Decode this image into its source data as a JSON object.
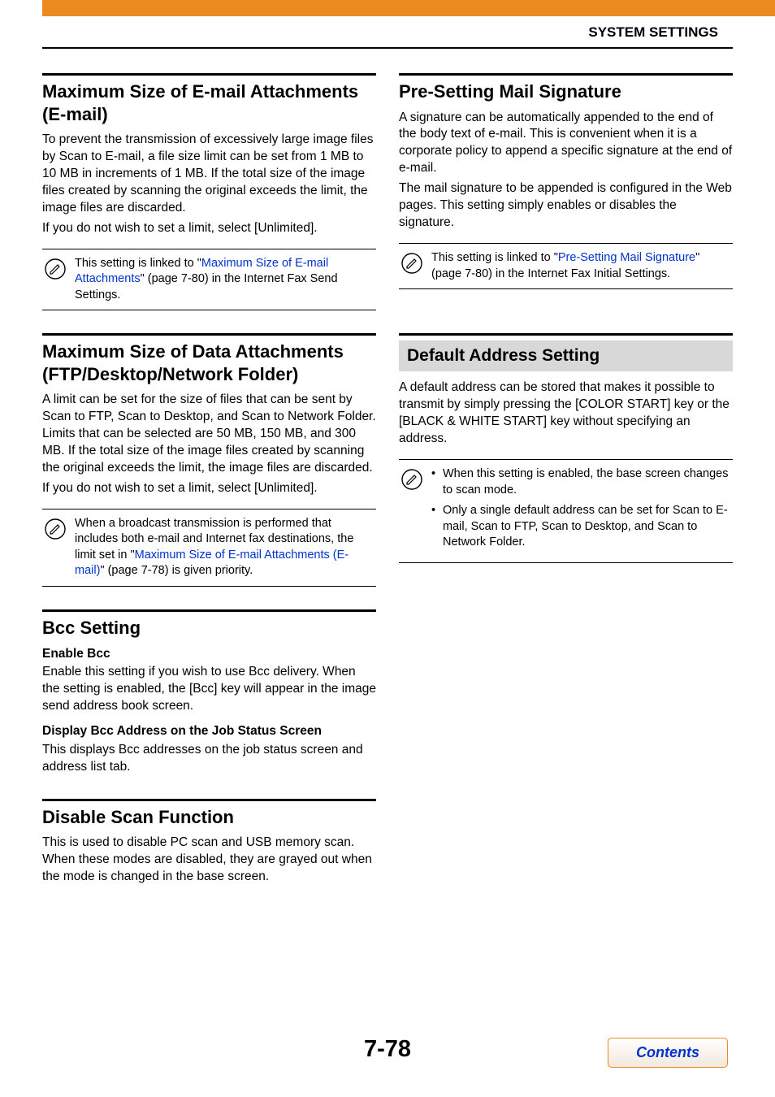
{
  "header": {
    "title": "SYSTEM SETTINGS"
  },
  "left": {
    "sec1": {
      "heading": "Maximum Size of E-mail Attachments (E-mail)",
      "p1": "To prevent the transmission of excessively large image files by Scan to E-mail, a file size limit can be set from 1 MB to 10 MB in increments of 1 MB. If the total size of the image files created by scanning the original exceeds the limit, the image files are discarded.",
      "p2": "If you do not wish to set a limit, select [Unlimited].",
      "note_a": "This setting is linked to \"",
      "note_link": "Maximum Size of E-mail Attachments",
      "note_b": "\" (page 7-80) in the Internet Fax Send Settings."
    },
    "sec2": {
      "heading": "Maximum Size of Data Attachments (FTP/Desktop/Network Folder)",
      "p1": "A limit can be set for the size of files that can be sent by Scan to FTP, Scan to Desktop, and Scan to Network Folder. Limits that can be selected are 50 MB, 150 MB, and 300 MB. If the total size of the image files created by scanning the original exceeds the limit, the image files are discarded.",
      "p2": "If you do not wish to set a limit, select [Unlimited].",
      "note_a": "When a broadcast transmission is performed that includes both e-mail and Internet fax destinations, the limit set in \"",
      "note_link": "Maximum Size of E-mail Attachments (E-mail)",
      "note_b": "\" (page 7-78) is given priority."
    },
    "sec3": {
      "heading": "Bcc Setting",
      "sub1": "Enable Bcc",
      "p1": "Enable this setting if you wish to use Bcc delivery. When the setting is enabled, the [Bcc] key will appear in the image send address book screen.",
      "sub2": "Display Bcc Address on the Job Status Screen",
      "p2": "This displays Bcc addresses on the job status screen and address list tab."
    },
    "sec4": {
      "heading": "Disable Scan Function",
      "p1": "This is used to disable PC scan and USB memory scan. When these modes are disabled, they are grayed out when the mode is changed in the base screen."
    }
  },
  "right": {
    "sec1": {
      "heading": "Pre-Setting Mail Signature",
      "p1": "A signature can be automatically appended to the end of the body text of e-mail. This is convenient when it is a corporate policy to append a specific signature at the end of e-mail.",
      "p2": "The mail signature to be appended is configured in the Web pages. This setting simply enables or disables the signature.",
      "note_a": "This setting is linked to \"",
      "note_link": "Pre-Setting Mail Signature",
      "note_b": "\" (page 7-80) in the Internet Fax Initial Settings."
    },
    "sec2": {
      "heading": "Default Address Setting",
      "p1": "A default address can be stored that makes it possible to transmit by simply pressing the [COLOR START] key or the [BLACK & WHITE START] key without specifying an address.",
      "bullet1": "When this setting is enabled, the base screen changes to scan mode.",
      "bullet2": "Only a single default address can be set for Scan to E-mail, Scan to FTP, Scan to Desktop, and Scan to Network Folder."
    }
  },
  "footer": {
    "page": "7-78",
    "contents": "Contents"
  }
}
